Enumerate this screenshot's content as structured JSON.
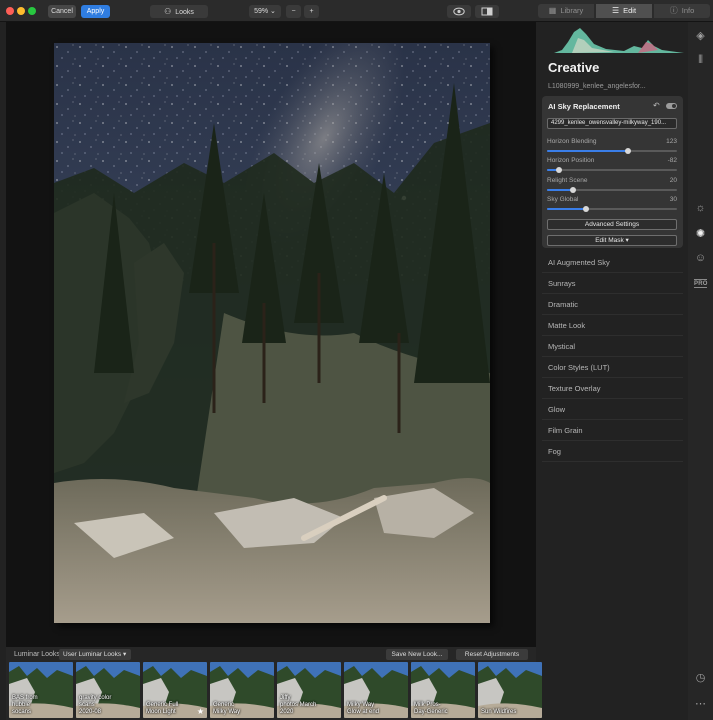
{
  "toolbar": {
    "cancel_label": "Cancel",
    "apply_label": "Apply",
    "looks_label": "Looks",
    "zoom_value": "59%",
    "zoom_out": "−",
    "zoom_in": "+",
    "tabs": [
      {
        "label": "Library",
        "active": false
      },
      {
        "label": "Edit",
        "active": true
      },
      {
        "label": "Info",
        "active": false
      }
    ]
  },
  "panel": {
    "title": "Creative",
    "filename": "L1080999_kenlee_angelesfor...",
    "sky_card": {
      "title": "AI Sky Replacement",
      "sky_file": "4299_kenlee_owensvalley-milkyway_190...",
      "sliders": [
        {
          "label": "Horizon Blending",
          "value": "123",
          "position": 0.62
        },
        {
          "label": "Horizon Position",
          "value": "-82",
          "position": 0.09
        },
        {
          "label": "Relight Scene",
          "value": "20",
          "position": 0.2
        },
        {
          "label": "Sky Global",
          "value": "30",
          "position": 0.3
        }
      ],
      "advanced_label": "Advanced Settings",
      "edit_mask_label": "Edit Mask ▾"
    },
    "tools": [
      "AI Augmented Sky",
      "Sunrays",
      "Dramatic",
      "Matte Look",
      "Mystical",
      "Color Styles (LUT)",
      "Texture Overlay",
      "Glow",
      "Film Grain",
      "Fog"
    ]
  },
  "looks_bar": {
    "label": "Luminar Looks:",
    "selected": "User Luminar Looks ▾",
    "save_label": "Save New Look...",
    "reset_label": "Reset Adjustments",
    "thumbs": [
      {
        "name": "BAS from\nhubble\nsocans",
        "starred": false
      },
      {
        "name": "gravity color\nscans\n2020-08",
        "starred": false
      },
      {
        "name": "Generic Full\nMoon Light",
        "starred": true
      },
      {
        "name": "Generic\nMilky Way",
        "starred": false
      },
      {
        "name": "Jiffy\nphotos March\n2020",
        "starred": false
      },
      {
        "name": "Milky Way\nGlow at end",
        "starred": false
      },
      {
        "name": "Milk Pros-\nDay-Generic",
        "starred": false
      },
      {
        "name": "Sun Wildfires",
        "starred": false
      }
    ]
  },
  "rail_icons": [
    "layers-icon",
    "sliders-panel-icon",
    "sun-icon",
    "palette-icon",
    "face-icon",
    "pro-icon",
    "history-icon",
    "more-icon"
  ],
  "colors": {
    "accent": "#2f7de1",
    "panel": "#222222",
    "card": "#353535"
  }
}
